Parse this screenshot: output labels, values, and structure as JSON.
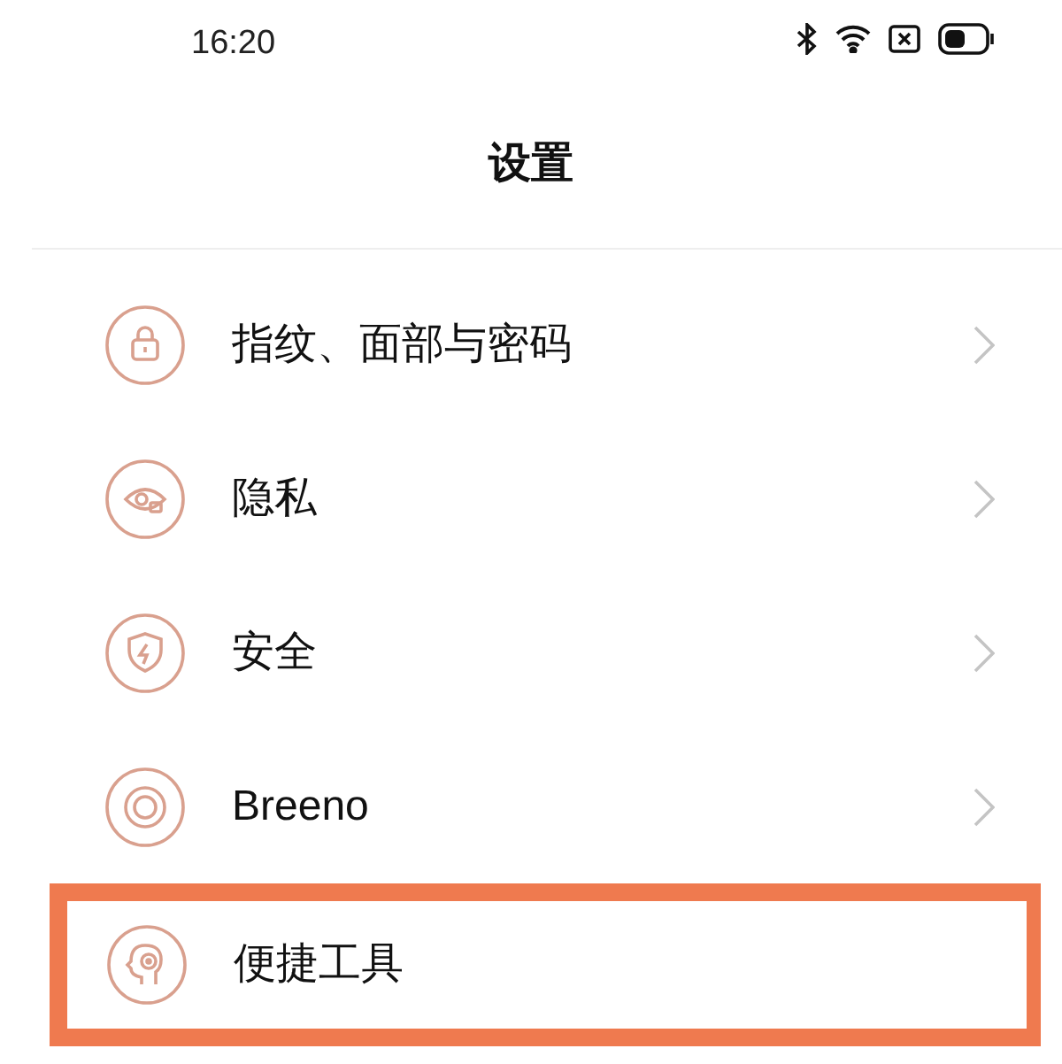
{
  "status_bar": {
    "time": "16:20"
  },
  "header": {
    "title": "设置"
  },
  "items": [
    {
      "label": "指纹、面部与密码",
      "chevron": true,
      "highlighted": false
    },
    {
      "label": "隐私",
      "chevron": true,
      "highlighted": false
    },
    {
      "label": "安全",
      "chevron": true,
      "highlighted": false
    },
    {
      "label": "Breeno",
      "chevron": true,
      "highlighted": false
    },
    {
      "label": "便捷工具",
      "chevron": false,
      "highlighted": true
    }
  ]
}
